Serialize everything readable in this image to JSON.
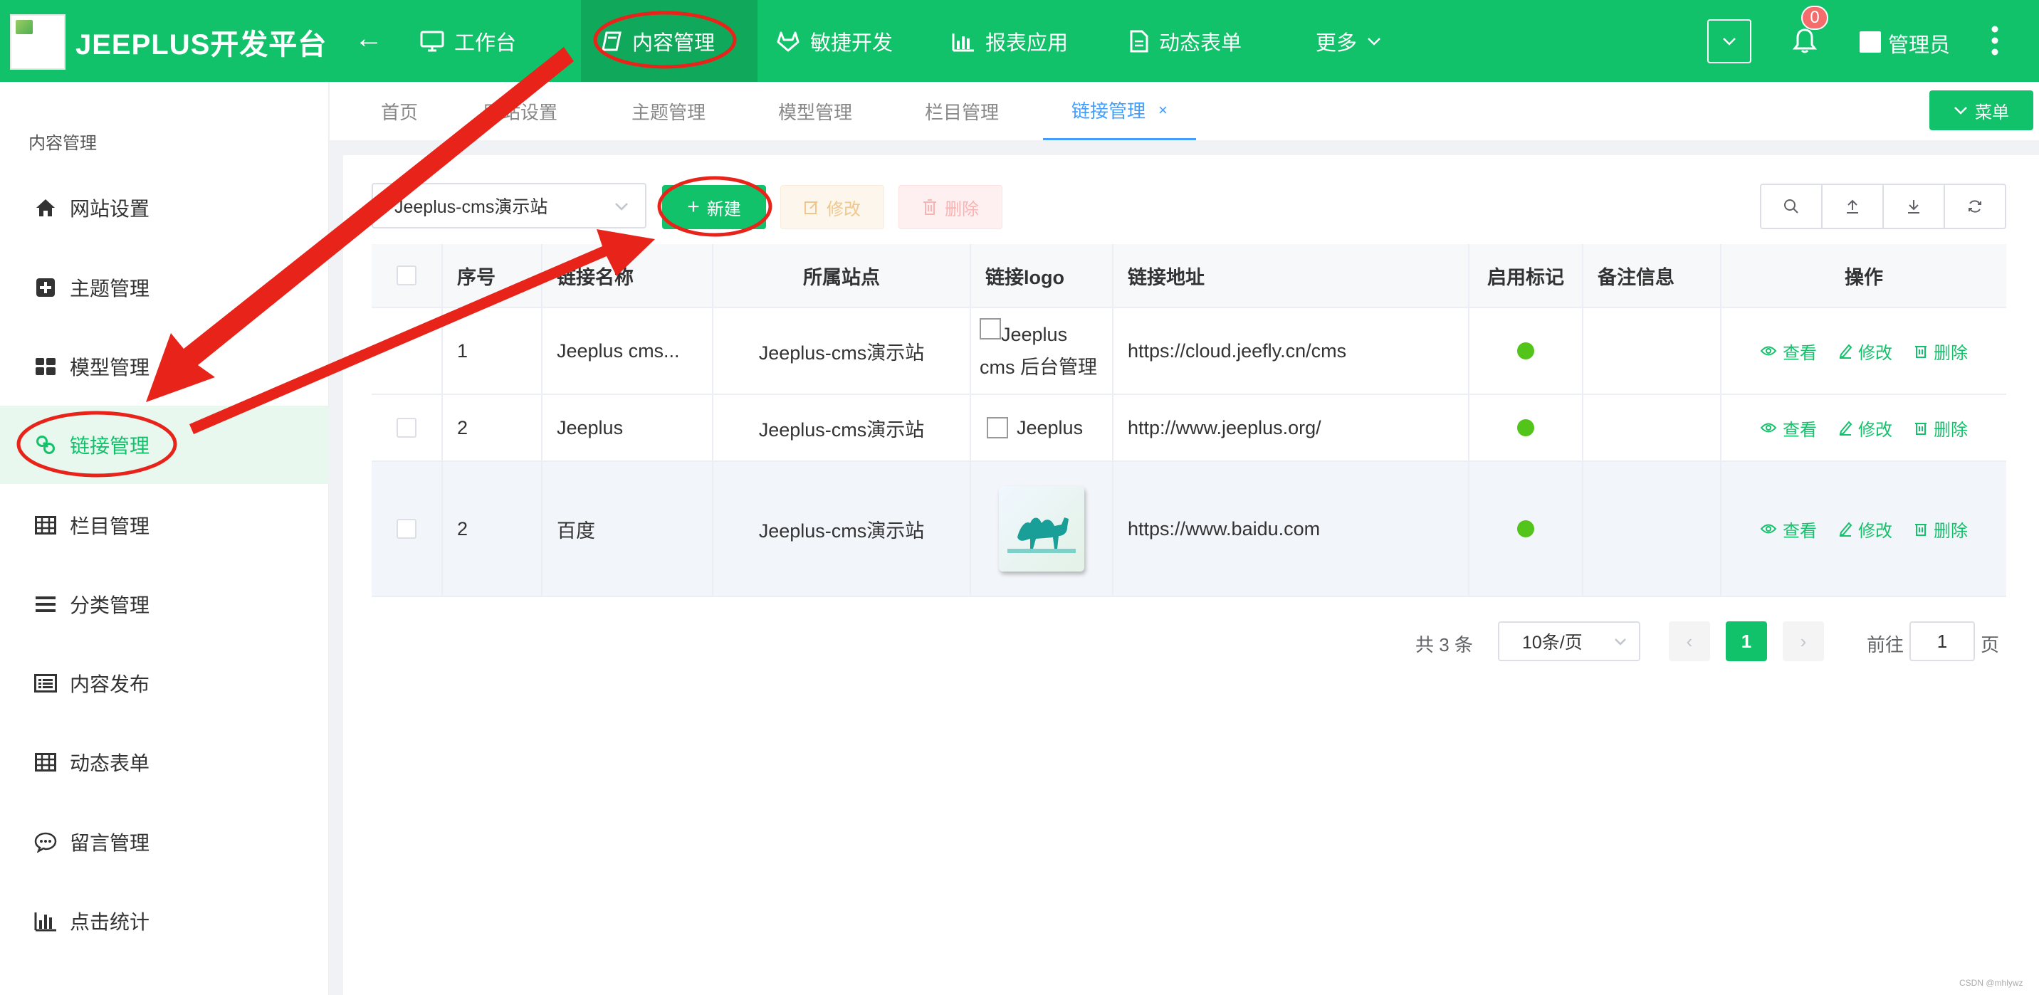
{
  "header": {
    "app_title": "JEEPLUS开发平台",
    "nav": [
      {
        "label": "工作台",
        "icon": "monitor-icon"
      },
      {
        "label": "内容管理",
        "icon": "book-icon",
        "active": true
      },
      {
        "label": "敏捷开发",
        "icon": "gitlab-icon"
      },
      {
        "label": "报表应用",
        "icon": "bar-chart-icon"
      },
      {
        "label": "动态表单",
        "icon": "document-icon"
      },
      {
        "label": "更多",
        "icon": "chevron-down-icon"
      }
    ],
    "notification_count": "0",
    "user_name": "管理员"
  },
  "sidebar": {
    "title": "内容管理",
    "items": [
      {
        "label": "网站设置",
        "icon": "home-icon"
      },
      {
        "label": "主题管理",
        "icon": "plus-square-icon"
      },
      {
        "label": "模型管理",
        "icon": "grid-icon"
      },
      {
        "label": "链接管理",
        "icon": "link-icon",
        "active": true
      },
      {
        "label": "栏目管理",
        "icon": "table-icon"
      },
      {
        "label": "分类管理",
        "icon": "list-icon"
      },
      {
        "label": "内容发布",
        "icon": "list-box-icon"
      },
      {
        "label": "动态表单",
        "icon": "table-icon"
      },
      {
        "label": "留言管理",
        "icon": "chat-icon"
      },
      {
        "label": "点击统计",
        "icon": "bar-chart-icon"
      }
    ]
  },
  "tabs": [
    {
      "label": "首页"
    },
    {
      "label": "网站设置"
    },
    {
      "label": "主题管理"
    },
    {
      "label": "模型管理"
    },
    {
      "label": "栏目管理"
    },
    {
      "label": "链接管理",
      "active": true
    }
  ],
  "menu_button": "菜单",
  "toolbar": {
    "site_select": "Jeeplus-cms演示站",
    "new_label": "新建",
    "edit_label": "修改",
    "delete_label": "删除"
  },
  "table": {
    "headers": {
      "index": "序号",
      "name": "链接名称",
      "site": "所属站点",
      "logo": "链接logo",
      "url": "链接地址",
      "enabled": "启用标记",
      "remark": "备注信息",
      "ops": "操作"
    },
    "rows": [
      {
        "index": "1",
        "name": "Jeeplus cms...",
        "site": "Jeeplus-cms演示站",
        "logo_text": "Jeeplus cms 后台管理",
        "url": "https://cloud.jeefly.cn/cms",
        "remark": ""
      },
      {
        "index": "2",
        "name": "Jeeplus",
        "site": "Jeeplus-cms演示站",
        "logo_text": "Jeeplus",
        "url": "http://www.jeeplus.org/",
        "remark": ""
      },
      {
        "index": "2",
        "name": "百度",
        "site": "Jeeplus-cms演示站",
        "logo_text": "",
        "url": "https://www.baidu.com",
        "remark": ""
      }
    ],
    "op_view": "查看",
    "op_edit": "修改",
    "op_delete": "删除"
  },
  "pagination": {
    "total_text": "共 3 条",
    "page_size": "10条/页",
    "current_page": "1",
    "goto_label": "前往",
    "goto_value": "1",
    "page_suffix": "页"
  },
  "watermark": "CSDN @mhlywz",
  "colors": {
    "primary": "#12c26a",
    "tab_active": "#409eff",
    "annotation": "#e8231a"
  }
}
